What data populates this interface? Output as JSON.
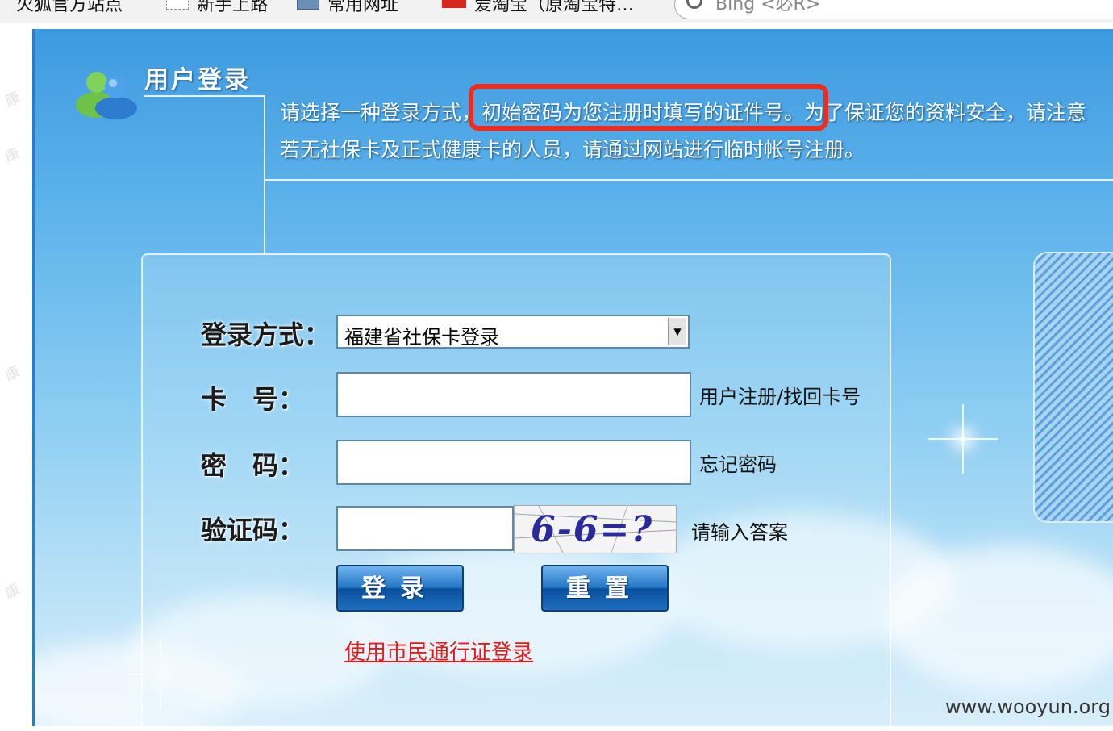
{
  "bookmarks": [
    {
      "label": "火狐官方站点",
      "icon": "none"
    },
    {
      "label": "新手上路",
      "icon": "dashed-page-icon"
    },
    {
      "label": "常用网址",
      "icon": "folder-icon"
    },
    {
      "label": "爱淘宝（原淘宝特…",
      "icon": "red-tao-icon"
    }
  ],
  "search": {
    "placeholder": "Bing <必R>"
  },
  "header": {
    "title": "用户登录",
    "notice_line1_part1": "请选择一种登录方式，",
    "notice_line1_highlight": "初始密码为您注册时填写的证件号。",
    "notice_line1_part2": "为了保证您的资料安全，请注意",
    "notice_line2": "若无社保卡及正式健康卡的人员，请通过网站进行临时帐号注册。"
  },
  "form": {
    "login_method_label": "登录方式：",
    "login_method_value": "福建省社保卡登录",
    "card_label": "卡　号：",
    "card_link": "用户注册/找回卡号",
    "password_label": "密　码：",
    "password_link": "忘记密码",
    "captcha_label": "验证码：",
    "captcha_image_text": "6-6=?",
    "captcha_hint": "请输入答案",
    "login_button": "登录",
    "reset_button": "重置",
    "citizen_link": "使用市民通行证登录"
  },
  "watermark": "www.wooyun.org",
  "colors": {
    "highlight_border": "#ee2b1c",
    "link_red": "#e81818",
    "button_blue": "#1f6fc0"
  }
}
